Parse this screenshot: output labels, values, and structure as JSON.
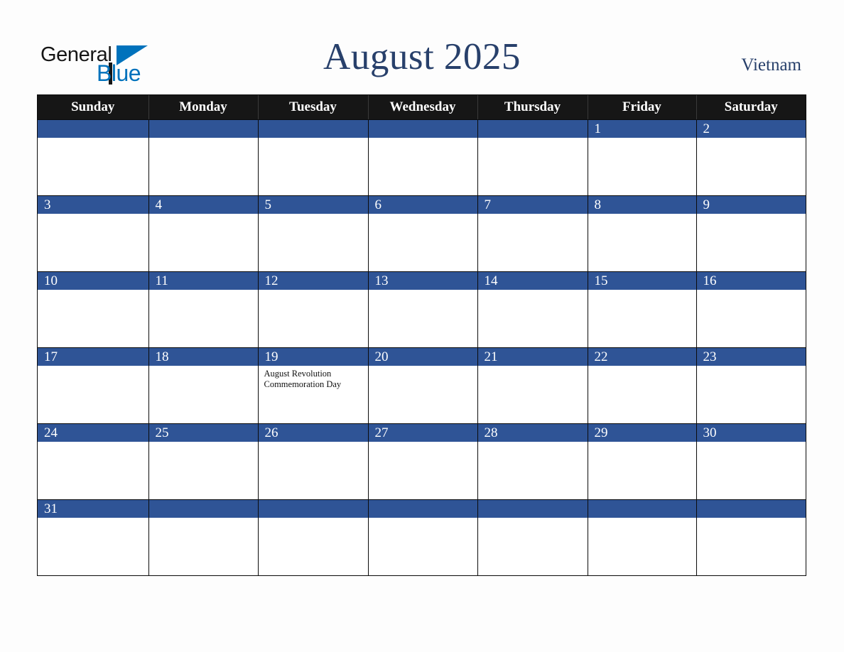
{
  "brand": {
    "name_top": "General",
    "name_bottom": "Blue",
    "triangle_icon": "triangle-icon",
    "color_black": "#161616",
    "color_blue": "#0072bc"
  },
  "header": {
    "title": "August 2025",
    "country": "Vietnam",
    "title_color": "#28406b"
  },
  "calendar": {
    "month": "August",
    "year": "2025",
    "weekday_headers": [
      "Sunday",
      "Monday",
      "Tuesday",
      "Wednesday",
      "Thursday",
      "Friday",
      "Saturday"
    ],
    "colors": {
      "header_bg": "#161616",
      "header_text": "#ffffff",
      "daynum_bg": "#2f5496",
      "daynum_text": "#ffffff",
      "cell_bg": "#ffffff",
      "grid_line": "#0b0b0b",
      "page_bg": "#fdfdfd"
    },
    "weeks": [
      [
        {
          "day": "",
          "events": []
        },
        {
          "day": "",
          "events": []
        },
        {
          "day": "",
          "events": []
        },
        {
          "day": "",
          "events": []
        },
        {
          "day": "",
          "events": []
        },
        {
          "day": "1",
          "events": []
        },
        {
          "day": "2",
          "events": []
        }
      ],
      [
        {
          "day": "3",
          "events": []
        },
        {
          "day": "4",
          "events": []
        },
        {
          "day": "5",
          "events": []
        },
        {
          "day": "6",
          "events": []
        },
        {
          "day": "7",
          "events": []
        },
        {
          "day": "8",
          "events": []
        },
        {
          "day": "9",
          "events": []
        }
      ],
      [
        {
          "day": "10",
          "events": []
        },
        {
          "day": "11",
          "events": []
        },
        {
          "day": "12",
          "events": []
        },
        {
          "day": "13",
          "events": []
        },
        {
          "day": "14",
          "events": []
        },
        {
          "day": "15",
          "events": []
        },
        {
          "day": "16",
          "events": []
        }
      ],
      [
        {
          "day": "17",
          "events": []
        },
        {
          "day": "18",
          "events": []
        },
        {
          "day": "19",
          "events": [
            "August Revolution Commemoration Day"
          ]
        },
        {
          "day": "20",
          "events": []
        },
        {
          "day": "21",
          "events": []
        },
        {
          "day": "22",
          "events": []
        },
        {
          "day": "23",
          "events": []
        }
      ],
      [
        {
          "day": "24",
          "events": []
        },
        {
          "day": "25",
          "events": []
        },
        {
          "day": "26",
          "events": []
        },
        {
          "day": "27",
          "events": []
        },
        {
          "day": "28",
          "events": []
        },
        {
          "day": "29",
          "events": []
        },
        {
          "day": "30",
          "events": []
        }
      ],
      [
        {
          "day": "31",
          "events": []
        },
        {
          "day": "",
          "events": []
        },
        {
          "day": "",
          "events": []
        },
        {
          "day": "",
          "events": []
        },
        {
          "day": "",
          "events": []
        },
        {
          "day": "",
          "events": []
        },
        {
          "day": "",
          "events": []
        }
      ]
    ]
  }
}
